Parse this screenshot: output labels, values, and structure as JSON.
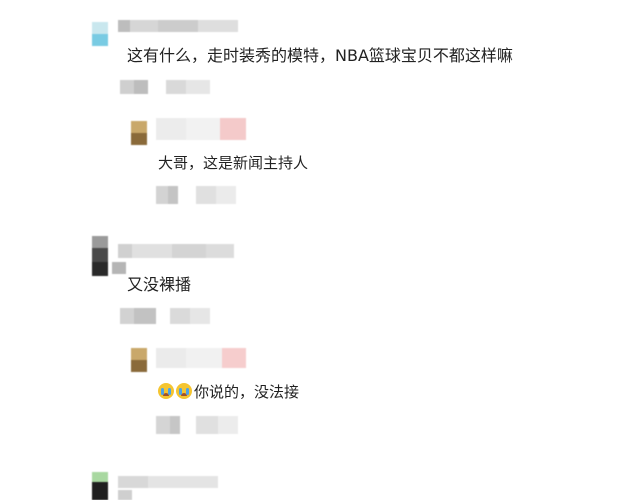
{
  "comments": [
    {
      "text": "这有什么，走时装秀的模特，NBA篮球宝贝不都这样嘛",
      "avatar_colors": [
        "#bfe3ea",
        "#7fd0e6"
      ],
      "name_colors": [
        "#c8c8c8",
        "#dcdcdc",
        "#d0d0d0",
        "#e0e0e0"
      ],
      "reply": {
        "text": "大哥，这是新闻主持人",
        "avatar_colors": [
          "#c9a86a",
          "#8a6a3a"
        ],
        "name_colors": [
          "#e8e8e8",
          "#f0f0f0",
          "#f3c8c8"
        ]
      }
    },
    {
      "text": "又没裸播",
      "avatar_colors": [
        "#6a6a6a",
        "#2a2a2a"
      ],
      "name_colors": [
        "#cfcfcf",
        "#dedede",
        "#d6d6d6"
      ],
      "reply": {
        "text": "你说的，没法接",
        "emoji_count": 2,
        "avatar_colors": [
          "#c9a86a",
          "#8a6a3a"
        ],
        "name_colors": [
          "#e6e6e6",
          "#efefef",
          "#f5cccc"
        ]
      }
    },
    {
      "text": "",
      "avatar_colors": [
        "#a8d8a0",
        "#1f1f1f"
      ],
      "name_colors": [
        "#d8d8d8",
        "#e4e4e4"
      ]
    }
  ]
}
